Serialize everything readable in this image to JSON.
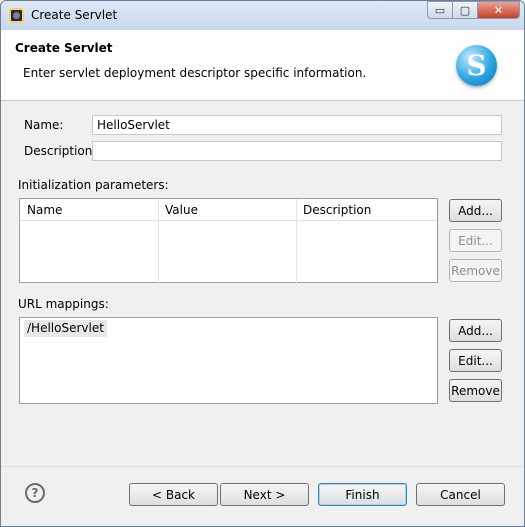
{
  "window": {
    "title": "Create Servlet",
    "controls": {
      "minimize": "▭",
      "maximize": "▢",
      "close": "✕"
    }
  },
  "header": {
    "title": "Create Servlet",
    "description": "Enter servlet deployment descriptor specific information.",
    "logo_glyph": "S",
    "logo_icon": "servlet-wizard-icon"
  },
  "form": {
    "name_label": "Name:",
    "name_value": "HelloServlet",
    "description_label": "Description:",
    "description_value": ""
  },
  "init_params": {
    "label": "Initialization parameters:",
    "columns": [
      "Name",
      "Value",
      "Description"
    ],
    "rows": [],
    "buttons": {
      "add": "Add...",
      "edit": "Edit...",
      "remove": "Remove"
    }
  },
  "url_mappings": {
    "label": "URL mappings:",
    "items": [
      "/HelloServlet"
    ],
    "buttons": {
      "add": "Add...",
      "edit": "Edit...",
      "remove": "Remove"
    }
  },
  "footer": {
    "help_glyph": "?",
    "back": "< Back",
    "next": "Next >",
    "finish": "Finish",
    "cancel": "Cancel"
  },
  "colors": {
    "titlebar": "#c7d7ec",
    "header_bg": "#ffffff",
    "dialog_bg": "#f0f0f0",
    "default_button_border": "#3c7fb1",
    "close_button": "#c4412b"
  }
}
